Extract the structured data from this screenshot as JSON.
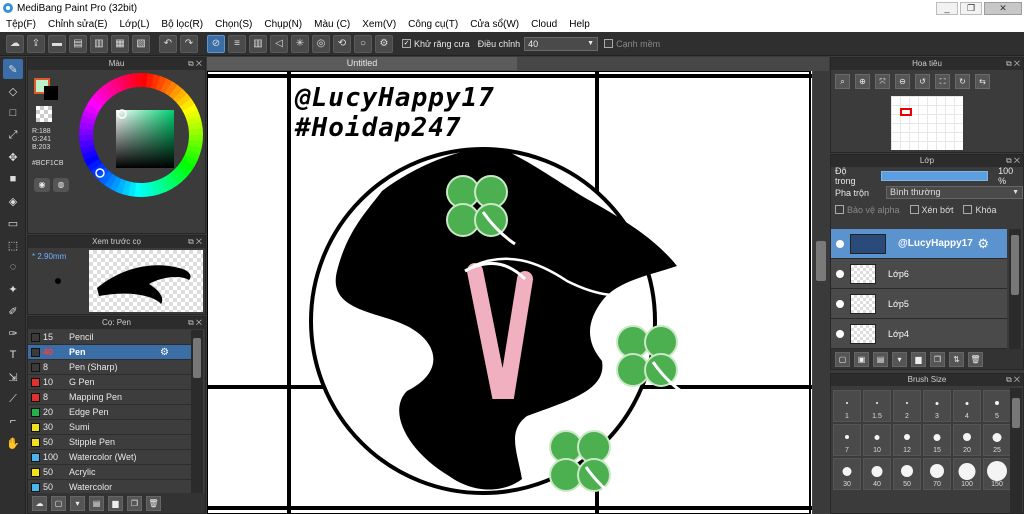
{
  "window": {
    "title": "MediBang Paint Pro (32bit)",
    "controls": [
      "_",
      "❐",
      "✕"
    ]
  },
  "menu": [
    "Tệp(F)",
    "Chỉnh sửa(E)",
    "Lớp(L)",
    "Bộ lọc(R)",
    "Chọn(S)",
    "Chụp(N)",
    "Màu (C)",
    "Xem(V)",
    "Công cụ(T)",
    "Cửa sổ(W)",
    "Cloud",
    "Help"
  ],
  "toolbar": {
    "antialias_label": "Khử răng cưa",
    "antialias_checked": "✓",
    "correction_label": "Điều chỉnh",
    "correction_value": "40",
    "sharp_label": "Cạnh mềm"
  },
  "color_panel": {
    "title": "Màu",
    "rgb": [
      "R:188",
      "G:241",
      "B:203"
    ],
    "hex": "#BCF1CB",
    "foreground": "#bcf1cb"
  },
  "brush_preview": {
    "title": "Xem trước cọ",
    "size": "2.90mm"
  },
  "brush_list": {
    "title": "Cọ: Pen",
    "items": [
      {
        "size": "15",
        "name": "Pencil",
        "color": "#3a3a3a"
      },
      {
        "size": "40",
        "name": "Pen",
        "color": "#3a3a3a"
      },
      {
        "size": "8",
        "name": "Pen (Sharp)",
        "color": "#3a3a3a"
      },
      {
        "size": "10",
        "name": "G Pen",
        "color": "#e03030"
      },
      {
        "size": "8",
        "name": "Mapping Pen",
        "color": "#e03030"
      },
      {
        "size": "20",
        "name": "Edge Pen",
        "color": "#22b14c"
      },
      {
        "size": "30",
        "name": "Sumi",
        "color": "#f0e020"
      },
      {
        "size": "50",
        "name": "Stipple Pen",
        "color": "#f0e020"
      },
      {
        "size": "100",
        "name": "Watercolor (Wet)",
        "color": "#49b4f0"
      },
      {
        "size": "50",
        "name": "Acrylic",
        "color": "#f0e020"
      },
      {
        "size": "50",
        "name": "Watercolor",
        "color": "#49b4f0"
      }
    ]
  },
  "canvas": {
    "tab": "Untitled",
    "text_line1": "@LucyHappy17",
    "text_line2": "#Hoidap247"
  },
  "navigator": {
    "title": "Hoa tiêu"
  },
  "layers": {
    "title": "Lớp",
    "opacity_label": "Độ trong",
    "opacity_value": "100 %",
    "opacity_fraction": 1.0,
    "blend_label": "Pha trộn",
    "blend_value": "Bình thường",
    "options": [
      "Bảo vệ alpha",
      "Xén bớt",
      "Khóa"
    ],
    "items": [
      "@LucyHappy17",
      "Lớp6",
      "Lớp5",
      "Lớp4"
    ]
  },
  "brush_size": {
    "title": "Brush Size",
    "sizes": [
      "1",
      "1.5",
      "2",
      "3",
      "4",
      "5",
      "7",
      "10",
      "12",
      "15",
      "20",
      "25",
      "30",
      "40",
      "50",
      "70",
      "100",
      "150"
    ]
  },
  "colors": {
    "accent": "#3b6ea6",
    "clover_green": "#4caf50",
    "swatch_red": "#e03030"
  }
}
